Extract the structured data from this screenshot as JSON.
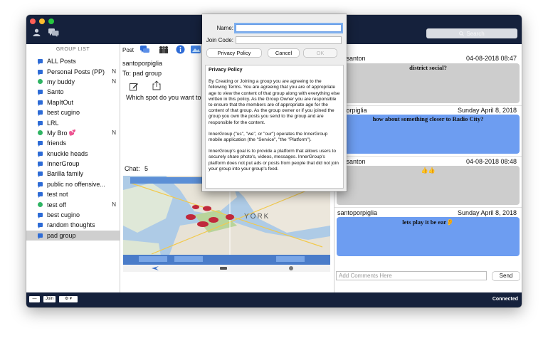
{
  "titlebar": {
    "search_placeholder": "Search"
  },
  "sidebar": {
    "header": "GROUP LIST",
    "items": [
      {
        "label": "ALL Posts",
        "icon": "chat",
        "flag": ""
      },
      {
        "label": "Personal Posts (PP)",
        "icon": "chat",
        "flag": "N"
      },
      {
        "label": "my buddy",
        "icon": "gear",
        "flag": "N"
      },
      {
        "label": "Santo",
        "icon": "chat",
        "flag": ""
      },
      {
        "label": "MapItOut",
        "icon": "chat",
        "flag": ""
      },
      {
        "label": "best cugino",
        "icon": "chat",
        "flag": ""
      },
      {
        "label": "LRL",
        "icon": "chat",
        "flag": ""
      },
      {
        "label": "My Bro",
        "icon": "gear",
        "flag": "N",
        "heart": "💕"
      },
      {
        "label": "friends",
        "icon": "chat",
        "flag": ""
      },
      {
        "label": "knuckle heads",
        "icon": "chat",
        "flag": ""
      },
      {
        "label": "InnerGroup",
        "icon": "chat",
        "flag": ""
      },
      {
        "label": "Barilla family",
        "icon": "chat",
        "flag": ""
      },
      {
        "label": "public no offensive...",
        "icon": "chat",
        "flag": ""
      },
      {
        "label": "test not",
        "icon": "chat",
        "flag": ""
      },
      {
        "label": "test off",
        "icon": "gear",
        "flag": "N"
      },
      {
        "label": "best cugino",
        "icon": "chat",
        "flag": ""
      },
      {
        "label": "random thoughts",
        "icon": "chat",
        "flag": ""
      },
      {
        "label": "pad group",
        "icon": "chat",
        "flag": "",
        "selected": true
      }
    ]
  },
  "middle": {
    "post_label": "Post",
    "user": "santoporpiglia",
    "to": "To: pad group",
    "prompt": "Which spot do you want to hit u",
    "chat_label": "Chat:",
    "chat_count": "5",
    "map_city": "YORK"
  },
  "dialog": {
    "name_label": "Name:",
    "name_value": "",
    "join_code_label": "Join Code:",
    "join_code_value": "",
    "privacy_button": "Privacy Policy",
    "cancel_button": "Cancel",
    "ok_button": "OK",
    "policy_title": "Privacy Policy",
    "policy_p1": "By Creating or Joining a group you are agreeing to the following Terms.  You are agreeing that you are of appropriate age to view the content of that group along with everything else written in this policy.  As the Group Owner you are responsible to ensure that the members are of appropriate age for the content of that group.  As the group owner or if you joined the group you own the posts you send to the group and are responsible for the content.",
    "policy_p2": "InnerGroup (\"us\", \"we\", or \"our\") operates the InnerGroup mobile application (the \"Service\", \"the \"Platform\").",
    "policy_p3": "InnerGroup's goal is to provide a platform that allows users to securely share photo's, videos, messages. InnerGroup's platform does not put ads or posts from people that did not join your group into your group's feed."
  },
  "right": {
    "header_fragment": "t",
    "messages": [
      {
        "user": "tonsanton",
        "date": "04-08-2018 08:47",
        "text": "district social?",
        "style": "gray"
      },
      {
        "user": "toporpiglia",
        "date": "Sunday April 8, 2018",
        "text": "how about something closer to Radio City?",
        "style": "blue"
      },
      {
        "user": "tonsanton",
        "date": "04-08-2018 08:48",
        "text": "👍👍",
        "style": "gray"
      },
      {
        "user": "santoporpiglia",
        "date": "Sunday April 8, 2018",
        "text": "lets play it be ear👂",
        "style": "blue"
      }
    ],
    "comment_placeholder": "Add Comments Here",
    "send_button": "Send"
  },
  "bottombar": {
    "minus_label": "—",
    "join_label": "Join",
    "settings_label": "⚙ ▾",
    "status": "Connected"
  },
  "colors": {
    "titlebar_bg": "#15213c",
    "accent_blue": "#6d9df1",
    "bubble_gray": "#cdcdcd",
    "chat_icon_blue": "#2d6bd6",
    "gear_icon_green": "#2fb463"
  }
}
